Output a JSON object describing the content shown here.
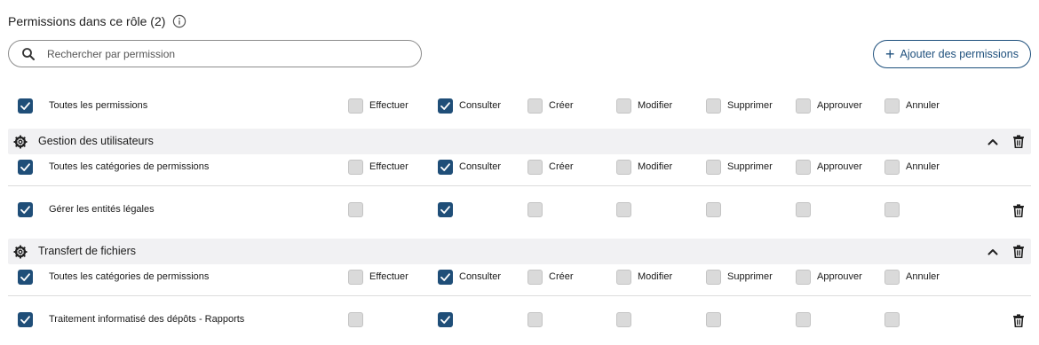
{
  "header": {
    "title": "Permissions dans ce rôle (2)"
  },
  "search": {
    "placeholder": "Rechercher par permission"
  },
  "actions": {
    "add_label": "Ajouter des permissions"
  },
  "permissions": [
    "Effectuer",
    "Consulter",
    "Créer",
    "Modifier",
    "Supprimer",
    "Approuver",
    "Annuler"
  ],
  "all_row": {
    "label": "Toutes les permissions",
    "checked": true,
    "states": [
      false,
      true,
      false,
      false,
      false,
      false,
      false
    ]
  },
  "sections": [
    {
      "title": "Gestion des utilisateurs",
      "all_categories": {
        "label": "Toutes les catégories de permissions",
        "checked": true,
        "states": [
          false,
          true,
          false,
          false,
          false,
          false,
          false
        ]
      },
      "items": [
        {
          "label": "Gérer les entités légales",
          "checked": true,
          "states": [
            false,
            true,
            false,
            false,
            false,
            false,
            false
          ]
        }
      ]
    },
    {
      "title": "Transfert de fichiers",
      "all_categories": {
        "label": "Toutes les catégories de permissions",
        "checked": true,
        "states": [
          false,
          true,
          false,
          false,
          false,
          false,
          false
        ]
      },
      "items": [
        {
          "label": "Traitement informatisé des dépôts - Rapports",
          "checked": true,
          "states": [
            false,
            true,
            false,
            false,
            false,
            false,
            false
          ]
        }
      ]
    }
  ],
  "colors": {
    "accent": "#1f4e78",
    "section_bg": "#f1f1f3",
    "unchecked": "#dadada"
  },
  "icons": {
    "info": "info-icon",
    "search": "search-icon",
    "gear": "gear-icon",
    "collapse": "chevron-up-icon",
    "delete": "trash-icon",
    "add": "plus-icon"
  }
}
